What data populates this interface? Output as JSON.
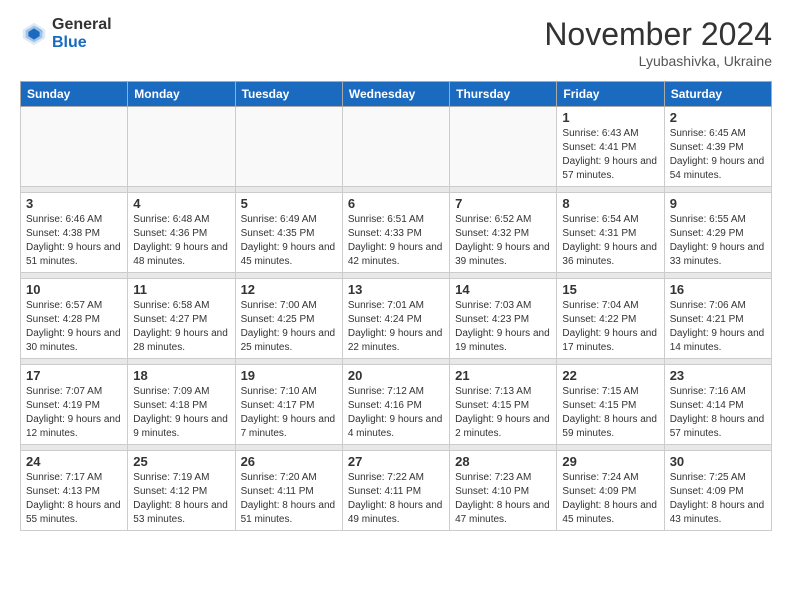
{
  "logo": {
    "general": "General",
    "blue": "Blue"
  },
  "header": {
    "month": "November 2024",
    "location": "Lyubashivka, Ukraine"
  },
  "weekdays": [
    "Sunday",
    "Monday",
    "Tuesday",
    "Wednesday",
    "Thursday",
    "Friday",
    "Saturday"
  ],
  "weeks": [
    {
      "days": [
        {
          "date": "",
          "sunrise": "",
          "sunset": "",
          "daylight": ""
        },
        {
          "date": "",
          "sunrise": "",
          "sunset": "",
          "daylight": ""
        },
        {
          "date": "",
          "sunrise": "",
          "sunset": "",
          "daylight": ""
        },
        {
          "date": "",
          "sunrise": "",
          "sunset": "",
          "daylight": ""
        },
        {
          "date": "",
          "sunrise": "",
          "sunset": "",
          "daylight": ""
        },
        {
          "date": "1",
          "sunrise": "Sunrise: 6:43 AM",
          "sunset": "Sunset: 4:41 PM",
          "daylight": "Daylight: 9 hours and 57 minutes."
        },
        {
          "date": "2",
          "sunrise": "Sunrise: 6:45 AM",
          "sunset": "Sunset: 4:39 PM",
          "daylight": "Daylight: 9 hours and 54 minutes."
        }
      ]
    },
    {
      "days": [
        {
          "date": "3",
          "sunrise": "Sunrise: 6:46 AM",
          "sunset": "Sunset: 4:38 PM",
          "daylight": "Daylight: 9 hours and 51 minutes."
        },
        {
          "date": "4",
          "sunrise": "Sunrise: 6:48 AM",
          "sunset": "Sunset: 4:36 PM",
          "daylight": "Daylight: 9 hours and 48 minutes."
        },
        {
          "date": "5",
          "sunrise": "Sunrise: 6:49 AM",
          "sunset": "Sunset: 4:35 PM",
          "daylight": "Daylight: 9 hours and 45 minutes."
        },
        {
          "date": "6",
          "sunrise": "Sunrise: 6:51 AM",
          "sunset": "Sunset: 4:33 PM",
          "daylight": "Daylight: 9 hours and 42 minutes."
        },
        {
          "date": "7",
          "sunrise": "Sunrise: 6:52 AM",
          "sunset": "Sunset: 4:32 PM",
          "daylight": "Daylight: 9 hours and 39 minutes."
        },
        {
          "date": "8",
          "sunrise": "Sunrise: 6:54 AM",
          "sunset": "Sunset: 4:31 PM",
          "daylight": "Daylight: 9 hours and 36 minutes."
        },
        {
          "date": "9",
          "sunrise": "Sunrise: 6:55 AM",
          "sunset": "Sunset: 4:29 PM",
          "daylight": "Daylight: 9 hours and 33 minutes."
        }
      ]
    },
    {
      "days": [
        {
          "date": "10",
          "sunrise": "Sunrise: 6:57 AM",
          "sunset": "Sunset: 4:28 PM",
          "daylight": "Daylight: 9 hours and 30 minutes."
        },
        {
          "date": "11",
          "sunrise": "Sunrise: 6:58 AM",
          "sunset": "Sunset: 4:27 PM",
          "daylight": "Daylight: 9 hours and 28 minutes."
        },
        {
          "date": "12",
          "sunrise": "Sunrise: 7:00 AM",
          "sunset": "Sunset: 4:25 PM",
          "daylight": "Daylight: 9 hours and 25 minutes."
        },
        {
          "date": "13",
          "sunrise": "Sunrise: 7:01 AM",
          "sunset": "Sunset: 4:24 PM",
          "daylight": "Daylight: 9 hours and 22 minutes."
        },
        {
          "date": "14",
          "sunrise": "Sunrise: 7:03 AM",
          "sunset": "Sunset: 4:23 PM",
          "daylight": "Daylight: 9 hours and 19 minutes."
        },
        {
          "date": "15",
          "sunrise": "Sunrise: 7:04 AM",
          "sunset": "Sunset: 4:22 PM",
          "daylight": "Daylight: 9 hours and 17 minutes."
        },
        {
          "date": "16",
          "sunrise": "Sunrise: 7:06 AM",
          "sunset": "Sunset: 4:21 PM",
          "daylight": "Daylight: 9 hours and 14 minutes."
        }
      ]
    },
    {
      "days": [
        {
          "date": "17",
          "sunrise": "Sunrise: 7:07 AM",
          "sunset": "Sunset: 4:19 PM",
          "daylight": "Daylight: 9 hours and 12 minutes."
        },
        {
          "date": "18",
          "sunrise": "Sunrise: 7:09 AM",
          "sunset": "Sunset: 4:18 PM",
          "daylight": "Daylight: 9 hours and 9 minutes."
        },
        {
          "date": "19",
          "sunrise": "Sunrise: 7:10 AM",
          "sunset": "Sunset: 4:17 PM",
          "daylight": "Daylight: 9 hours and 7 minutes."
        },
        {
          "date": "20",
          "sunrise": "Sunrise: 7:12 AM",
          "sunset": "Sunset: 4:16 PM",
          "daylight": "Daylight: 9 hours and 4 minutes."
        },
        {
          "date": "21",
          "sunrise": "Sunrise: 7:13 AM",
          "sunset": "Sunset: 4:15 PM",
          "daylight": "Daylight: 9 hours and 2 minutes."
        },
        {
          "date": "22",
          "sunrise": "Sunrise: 7:15 AM",
          "sunset": "Sunset: 4:15 PM",
          "daylight": "Daylight: 8 hours and 59 minutes."
        },
        {
          "date": "23",
          "sunrise": "Sunrise: 7:16 AM",
          "sunset": "Sunset: 4:14 PM",
          "daylight": "Daylight: 8 hours and 57 minutes."
        }
      ]
    },
    {
      "days": [
        {
          "date": "24",
          "sunrise": "Sunrise: 7:17 AM",
          "sunset": "Sunset: 4:13 PM",
          "daylight": "Daylight: 8 hours and 55 minutes."
        },
        {
          "date": "25",
          "sunrise": "Sunrise: 7:19 AM",
          "sunset": "Sunset: 4:12 PM",
          "daylight": "Daylight: 8 hours and 53 minutes."
        },
        {
          "date": "26",
          "sunrise": "Sunrise: 7:20 AM",
          "sunset": "Sunset: 4:11 PM",
          "daylight": "Daylight: 8 hours and 51 minutes."
        },
        {
          "date": "27",
          "sunrise": "Sunrise: 7:22 AM",
          "sunset": "Sunset: 4:11 PM",
          "daylight": "Daylight: 8 hours and 49 minutes."
        },
        {
          "date": "28",
          "sunrise": "Sunrise: 7:23 AM",
          "sunset": "Sunset: 4:10 PM",
          "daylight": "Daylight: 8 hours and 47 minutes."
        },
        {
          "date": "29",
          "sunrise": "Sunrise: 7:24 AM",
          "sunset": "Sunset: 4:09 PM",
          "daylight": "Daylight: 8 hours and 45 minutes."
        },
        {
          "date": "30",
          "sunrise": "Sunrise: 7:25 AM",
          "sunset": "Sunset: 4:09 PM",
          "daylight": "Daylight: 8 hours and 43 minutes."
        }
      ]
    }
  ]
}
